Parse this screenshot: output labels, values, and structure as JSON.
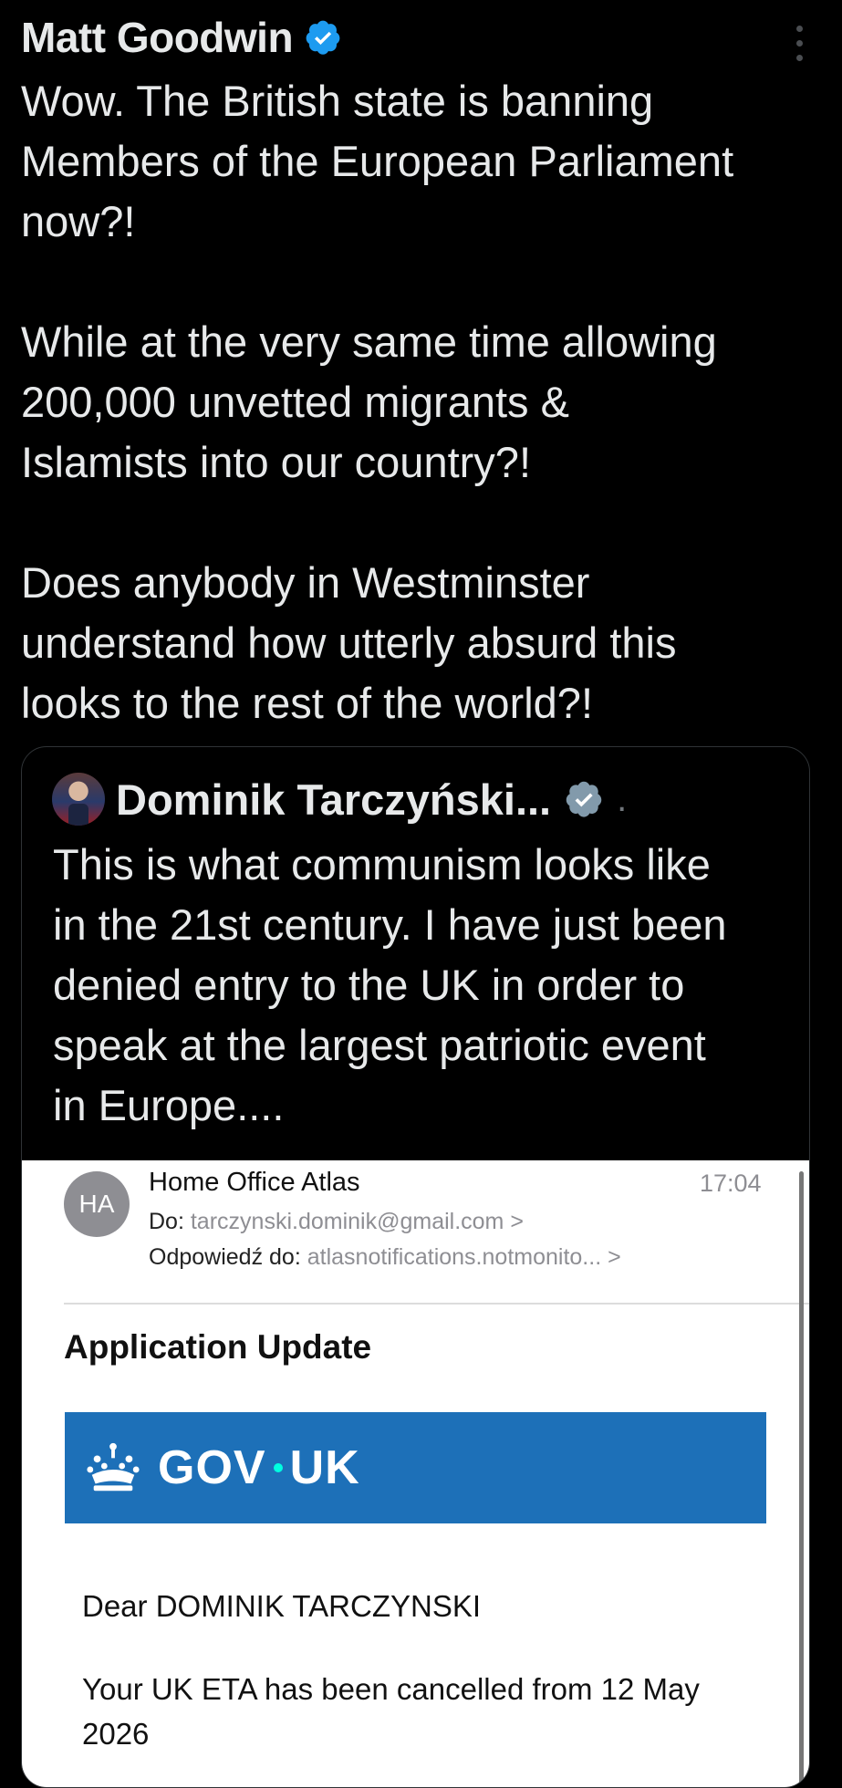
{
  "tweet": {
    "author_name": "Matt Goodwin",
    "text": "Wow. The British state is banning\nMembers of the European Parliament\nnow?!\n\nWhile at the very same time allowing\n200,000 unvetted migrants &\nIslamists into our country?!\n\nDoes anybody in Westminster\nunderstand how utterly absurd this\nlooks to the rest of the world?!"
  },
  "quote": {
    "author_name": "Dominik Tarczyński...",
    "dot": ".",
    "text": "This is what communism looks like\nin the 21st century. I have just been\ndenied entry to the UK in order to\nspeak at the largest patriotic event\nin Europe...."
  },
  "email": {
    "avatar_initials": "HA",
    "sender": "Home Office Atlas",
    "time": "17:04",
    "to_label": "Do:",
    "to_value": "tarczynski.dominik@gmail.com",
    "reply_label": "Odpowiedź do:",
    "reply_value": "atlasnotifications.notmonito...",
    "chevron": ">",
    "subject": "Application Update",
    "banner_left": "GOV",
    "banner_right": "UK",
    "greeting": "Dear DOMINIK TARCZYNSKI",
    "body": "Your UK ETA has been cancelled from 12 May 2026"
  },
  "colors": {
    "background": "#000000",
    "verified_blue": "#1d9bf0",
    "verified_gray": "#829aab",
    "gov_blue": "#1d70b8"
  },
  "icons": [
    "verified-badge-icon",
    "more-options-icon",
    "crown-icon",
    "chevron-right-icon"
  ]
}
